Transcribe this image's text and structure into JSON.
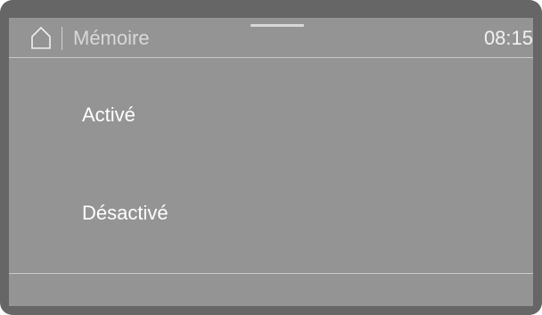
{
  "header": {
    "title": "Mémoire",
    "clock": "08:15",
    "home_icon": "home-icon"
  },
  "options": [
    {
      "label": "Activé"
    },
    {
      "label": "Désactivé"
    }
  ],
  "colors": {
    "bezel": "#666666",
    "screen": "#949494",
    "text": "#ffffff",
    "divider": "#c9c9c9"
  }
}
